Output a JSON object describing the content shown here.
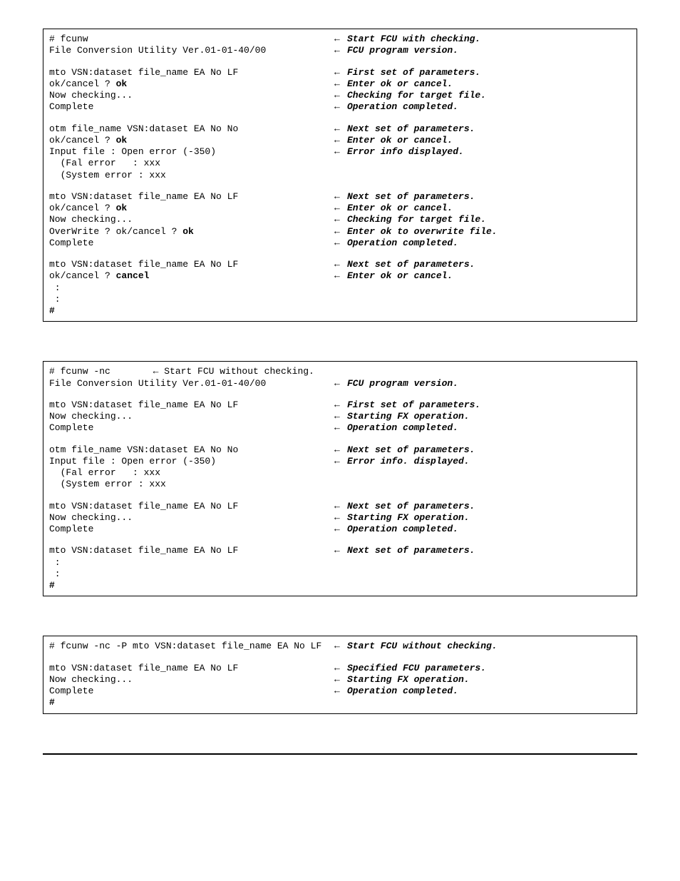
{
  "box1": {
    "lines": [
      {
        "l": "# fcunw",
        "a": "←",
        "c": "Start FCU with checking."
      },
      {
        "l": "File Conversion Utility Ver.01-01-40/00",
        "a": "←",
        "c": "FCU program version."
      },
      {
        "type": "spacer"
      },
      {
        "l": "mto VSN:dataset file_name EA No LF",
        "a": "←",
        "c": "First set of parameters."
      },
      {
        "l": "ok/cancel ? ",
        "b": "ok",
        "a": "←",
        "c": "Enter ok or cancel."
      },
      {
        "l": "Now checking...",
        "a": "←",
        "c": "Checking for target file."
      },
      {
        "l": "Complete",
        "a": "←",
        "c": "Operation completed."
      },
      {
        "type": "spacer"
      },
      {
        "l": "otm file_name VSN:dataset EA No No",
        "a": "←",
        "c": "Next set of parameters."
      },
      {
        "l": "ok/cancel ? ",
        "b": "ok",
        "a": "←",
        "c": "Enter ok or cancel."
      },
      {
        "l": "Input file : Open error (-350)",
        "a": "←",
        "c": "Error info displayed."
      },
      {
        "l": "  (Fal error   : xxx"
      },
      {
        "l": "  (System error : xxx"
      },
      {
        "type": "spacer"
      },
      {
        "l": "mto VSN:dataset file_name EA No LF",
        "a": "←",
        "c": "Next set of parameters."
      },
      {
        "l": "ok/cancel ? ",
        "b": "ok",
        "a": "←",
        "c": "Enter ok or cancel."
      },
      {
        "l": "Now checking...",
        "a": "←",
        "c": "Checking for target file."
      },
      {
        "l": "OverWrite ? ok/cancel ? ",
        "b": "ok",
        "a": "←",
        "c": "Enter ok to overwrite file."
      },
      {
        "l": "Complete",
        "a": "←",
        "c": "Operation completed."
      },
      {
        "type": "spacer"
      },
      {
        "l": "mto VSN:dataset file_name EA No LF",
        "a": "←",
        "c": "Next set of parameters."
      },
      {
        "l": "ok/cancel ? ",
        "b": "cancel",
        "a": "←",
        "c": "Enter ok or cancel."
      },
      {
        "l": " :"
      },
      {
        "l": " :"
      },
      {
        "l": "",
        "b": "#"
      }
    ]
  },
  "box2": {
    "header": {
      "l": "# fcunw -nc",
      "a": "←",
      "c": "Start FCU without checking."
    },
    "lines": [
      {
        "l": "File Conversion Utility Ver.01-01-40/00",
        "a": "←",
        "c": "FCU program version."
      },
      {
        "type": "spacer"
      },
      {
        "l": "mto VSN:dataset file_name EA No LF",
        "a": "←",
        "c": "First set of parameters."
      },
      {
        "l": "Now checking...",
        "a": "←",
        "c": "Starting FX operation."
      },
      {
        "l": "Complete",
        "a": "←",
        "c": "Operation completed."
      },
      {
        "type": "spacer"
      },
      {
        "l": "otm file_name VSN:dataset EA No No",
        "a": "←",
        "c": "Next set of parameters."
      },
      {
        "l": "Input file : Open error (-350)",
        "a": "←",
        "c": "Error info. displayed."
      },
      {
        "l": "  (Fal error   : xxx"
      },
      {
        "l": "  (System error : xxx"
      },
      {
        "type": "spacer"
      },
      {
        "l": "mto VSN:dataset file_name EA No LF",
        "a": "←",
        "c": "Next set of parameters."
      },
      {
        "l": "Now checking...",
        "a": "←",
        "c": "Starting FX operation."
      },
      {
        "l": "Complete",
        "a": "←",
        "c": "Operation completed."
      },
      {
        "type": "spacer"
      },
      {
        "l": "mto VSN:dataset file_name EA No LF",
        "a": "←",
        "c": "Next set of parameters."
      },
      {
        "l": " :"
      },
      {
        "l": " :"
      },
      {
        "l": "",
        "b": "#"
      }
    ]
  },
  "box3": {
    "lines": [
      {
        "l": "# fcunw -nc -P mto VSN:dataset file_name EA No LF",
        "a": "←",
        "c": "Start FCU without checking."
      },
      {
        "type": "spacer"
      },
      {
        "l": "mto VSN:dataset file_name EA No LF",
        "a": "←",
        "c": "Specified FCU parameters."
      },
      {
        "l": "Now checking...",
        "a": "←",
        "c": "Starting FX operation."
      },
      {
        "l": "Complete",
        "a": "←",
        "c": "Operation completed."
      },
      {
        "l": "",
        "b": "#"
      }
    ]
  }
}
